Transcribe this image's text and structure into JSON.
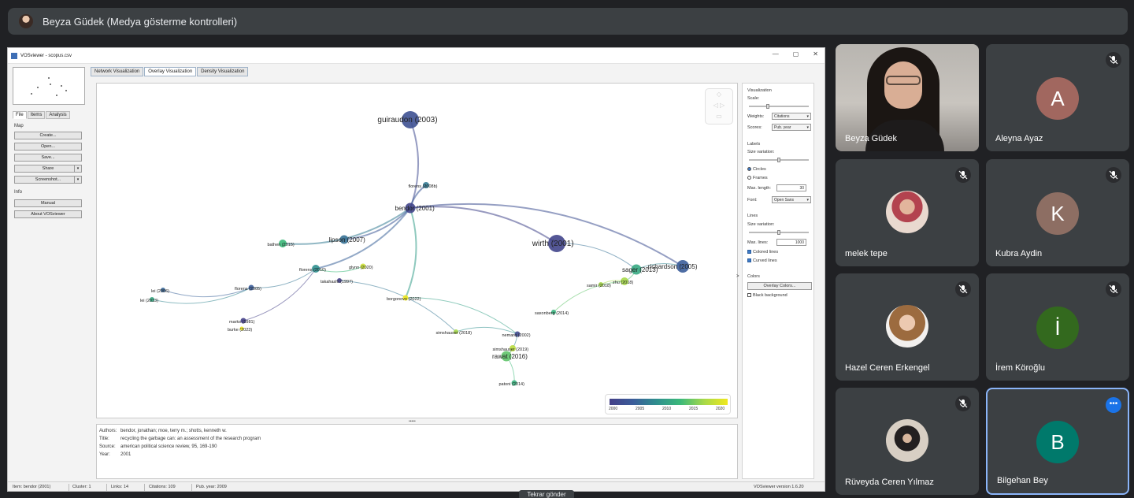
{
  "presenter": {
    "title": "Beyza Güdek (Medya gösterme kontrolleri)"
  },
  "window": {
    "title": "VOSviewer - scopus.csv",
    "controls": [
      "—",
      "▢",
      "✕"
    ]
  },
  "left_panel": {
    "tabs": [
      "File",
      "Items",
      "Analysis"
    ],
    "map_header": "Map",
    "buttons": [
      "Create...",
      "Open...",
      "Save...",
      "Share",
      "Screenshot..."
    ],
    "info_header": "Info",
    "info_buttons": [
      "Manual",
      "About VOSviewer"
    ]
  },
  "vis_tabs": [
    "Network Visualization",
    "Overlay Visualization",
    "Density Visualization"
  ],
  "network": {
    "nodes": [
      {
        "label": "guiraudon (2003)",
        "year": 2003,
        "size": 20
      },
      {
        "label": "bendor (2001)",
        "year": 2001,
        "size": 11
      },
      {
        "label": "florens (2008b)",
        "year": 2008,
        "size": 6
      },
      {
        "label": "richardson (2005)",
        "year": 2005,
        "size": 14
      },
      {
        "label": "wirth (2001)",
        "year": 2001,
        "size": 20
      },
      {
        "label": "sager (2013)",
        "year": 2013,
        "size": 11
      },
      {
        "label": "zhu (2018)",
        "year": 2018,
        "size": 8
      },
      {
        "label": "bathen (2015)",
        "year": 2015,
        "size": 8
      },
      {
        "label": "lipson (2007)",
        "year": 2007,
        "size": 9
      },
      {
        "label": "florens (2010)",
        "year": 2010,
        "size": 8
      },
      {
        "label": "florens (2005)",
        "year": 2005,
        "size": 5
      },
      {
        "label": "glynn (2020)",
        "year": 2020,
        "size": 5
      },
      {
        "label": "takahashi (1997)",
        "year": 1997,
        "size": 4
      },
      {
        "label": "borgonovo (2022)",
        "year": 2022,
        "size": 5
      },
      {
        "label": "lei (2006)",
        "year": 2006,
        "size": 4
      },
      {
        "label": "lei (2013)",
        "year": 2013,
        "size": 4
      },
      {
        "label": "marks (1981)",
        "year": 1981,
        "size": 5
      },
      {
        "label": "burke (2023)",
        "year": 2023,
        "size": 3
      },
      {
        "label": "simshauser (2018)",
        "year": 2018,
        "size": 4
      },
      {
        "label": "nemarq (2002)",
        "year": 2002,
        "size": 5
      },
      {
        "label": "simshauser (2019)",
        "year": 2019,
        "size": 6
      },
      {
        "label": "rawat (2016)",
        "year": 2016,
        "size": 11
      },
      {
        "label": "saxonberg (2014)",
        "year": 2014,
        "size": 4
      },
      {
        "label": "samir (2018)",
        "year": 2018,
        "size": 4
      },
      {
        "label": "patoni (2014)",
        "year": 2014,
        "size": 5
      }
    ],
    "legend_ticks": [
      "2000",
      "2005",
      "2010",
      "2015",
      "2020"
    ]
  },
  "info": {
    "rows": [
      {
        "label": "Authors:",
        "value": "bendor, jonathan; moe, terry m.; shotts, kenneth w."
      },
      {
        "label": "Title:",
        "value": "recycling the garbage can: an assessment of the research program"
      },
      {
        "label": "Source:",
        "value": "american political science review, 95, 169-190"
      },
      {
        "label": "Year:",
        "value": "2001"
      }
    ]
  },
  "right_panel": {
    "visualization": "Visualization",
    "scale": "Scale:",
    "weights_label": "Weights:",
    "weights_value": "Citations",
    "scores_label": "Scores:",
    "scores_value": "Pub. year",
    "labels": "Labels",
    "size_variation": "Size variation:",
    "circles": "Circles",
    "frames": "Frames",
    "max_length_label": "Max. length:",
    "max_length_value": "30",
    "font_label": "Font:",
    "font_value": "Open Sans",
    "lines": "Lines",
    "lines_size_variation": "Size variation:",
    "max_lines_label": "Max. lines:",
    "max_lines_value": "1000",
    "colored_lines": "Colored lines",
    "curved_lines": "Curved lines",
    "colors": "Colors",
    "overlay_colors": "Overlay Colors...",
    "black_background": "Black background"
  },
  "status_bar": {
    "item": "Item:  bendor (2001)",
    "cluster": "Cluster:  1",
    "links": "Links:  14",
    "citations": "Citations:  109",
    "pub_year": "Pub. year:  2009",
    "version": "VOSviewer version 1.6.20"
  },
  "tooltip": "Tekrar gönder",
  "participants": [
    {
      "name": "Beyza Güdek",
      "type": "video"
    },
    {
      "name": "Aleyna Ayaz",
      "letter": "A",
      "color": "#a1675f"
    },
    {
      "name": "melek tepe",
      "type": "photo"
    },
    {
      "name": "Kubra Aydin",
      "letter": "K",
      "color": "#8d6e63"
    },
    {
      "name": "Hazel Ceren Erkengel",
      "type": "photo"
    },
    {
      "name": "İrem Köroğlu",
      "letter": "İ",
      "color": "#33691e"
    },
    {
      "name": "Rüveyda Ceren Yılmaz",
      "type": "photo"
    },
    {
      "name": "Bilgehan Bey",
      "letter": "B",
      "color": "#00796b"
    }
  ]
}
